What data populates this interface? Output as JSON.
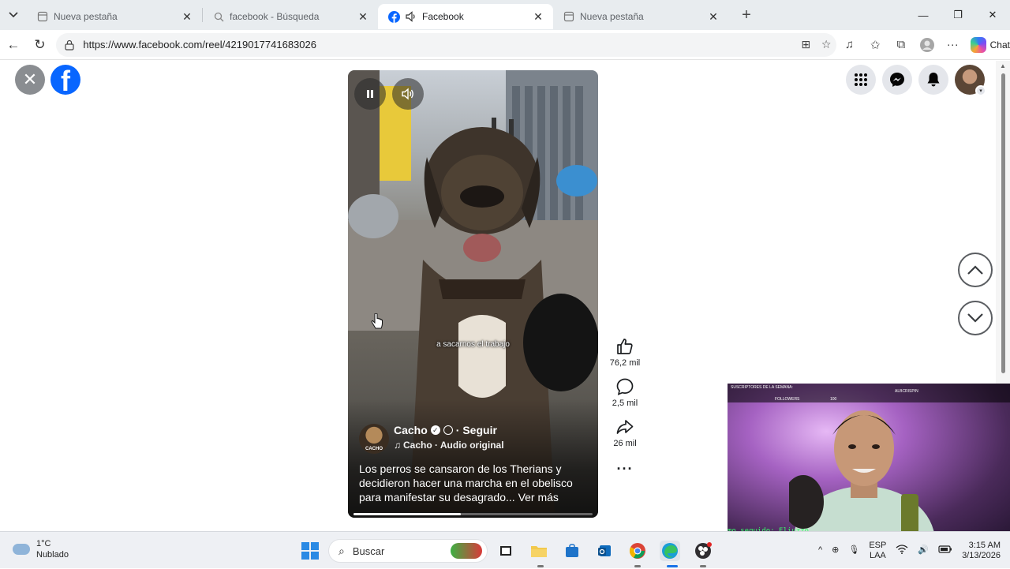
{
  "browser": {
    "tabs": [
      {
        "title": "Nueva pestaña",
        "icon": "page-icon",
        "active": false
      },
      {
        "title": "facebook - Búsqueda",
        "icon": "search-icon",
        "active": false
      },
      {
        "title": "Facebook",
        "icon": "facebook-icon",
        "active": true
      },
      {
        "title": "Nueva pestaña",
        "icon": "page-icon",
        "active": false
      }
    ],
    "url": "https://www.facebook.com/reel/4219017741683026",
    "chat_label": "Chat"
  },
  "reel": {
    "subtitle": "a sacarnos el trabajo",
    "author": {
      "name": "Cacho",
      "follow_label": "· Seguir",
      "avatar_text": "CACHO",
      "audio": "Cacho · Audio original"
    },
    "caption": "Los perros se cansaron de los Therians y decidieron hacer una marcha en el obelisco para manifestar su desagrado...",
    "see_more": "Ver más",
    "progress_fraction": 0.45,
    "actions": {
      "likes": "76,2 mil",
      "comments": "2,5 mil",
      "shares": "26 mil"
    }
  },
  "webcam": {
    "hud_title": "SUSCRIPTORES DE LA SEMANA:",
    "hud_right": "ALBCRISPIN",
    "hud_followers": "FOLLOWERS",
    "hud_count": "100",
    "ticker": "mo_seguido: Eliuzzo"
  },
  "taskbar": {
    "weather_temp": "1°C",
    "weather_desc": "Nublado",
    "search_placeholder": "Buscar",
    "lang_top": "ESP",
    "lang_bottom": "LAA",
    "time": "3:15 AM",
    "date": "3/13/2026"
  }
}
